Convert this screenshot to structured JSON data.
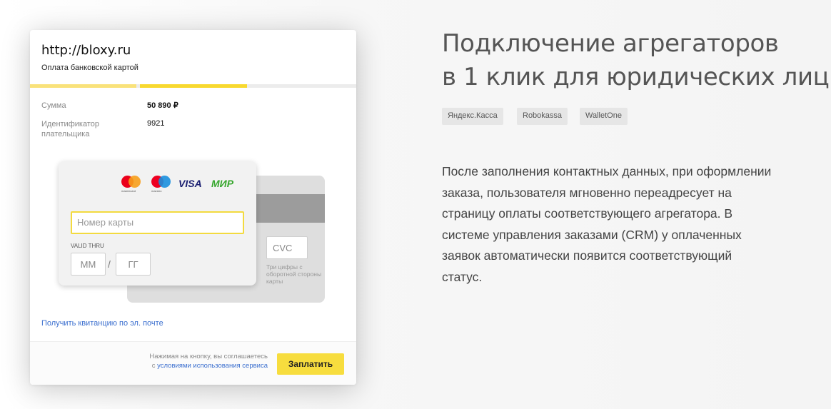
{
  "widget": {
    "url": "http://bloxy.ru",
    "subtitle": "Оплата банковской картой",
    "rows": [
      {
        "label": "Сумма",
        "value": "50 890 ₽"
      },
      {
        "label_line1": "Идентификатор",
        "label_line2": "плательщика",
        "value": "9921"
      }
    ],
    "card": {
      "logos": {
        "mastercard_caption": "mastercard",
        "maestro_caption": "maestro",
        "visa": "VISA",
        "mir": "МИР"
      },
      "number_placeholder": "Номер карты",
      "valid_label": "VALID THRU",
      "month_placeholder": "ММ",
      "separator": "/",
      "year_placeholder": "ГГ",
      "cvc_placeholder": "CVC",
      "cvc_hint": "Три цифры с оборотной стороны карты"
    },
    "receipt_link": "Получить квитанцию по эл. почте",
    "footer": {
      "terms_line1": "Нажимая на кнопку, вы соглашаетесь",
      "terms_prefix": "с",
      "terms_link": "условиями использования сервиса",
      "pay_button": "Заплатить"
    },
    "colors": {
      "accent_yellow": "#f7dd3e",
      "link_blue": "#3b6fcf"
    }
  },
  "content": {
    "heading_line1": "Подключение агрегаторов",
    "heading_line2": "в 1 клик для юридических лиц",
    "tags": [
      "Яндекс.Касса",
      "Robokassa",
      "WalletOne"
    ],
    "description_lines": [
      "После заполнения контактных данных, при оформлении",
      "заказа, пользователя мгновенно переадресует на",
      "страницу оплаты соответствующего агрегатора. В",
      "системе управления заказами (CRM) у оплаченных",
      "заявок автоматически появится соответствующий",
      "статус."
    ]
  }
}
